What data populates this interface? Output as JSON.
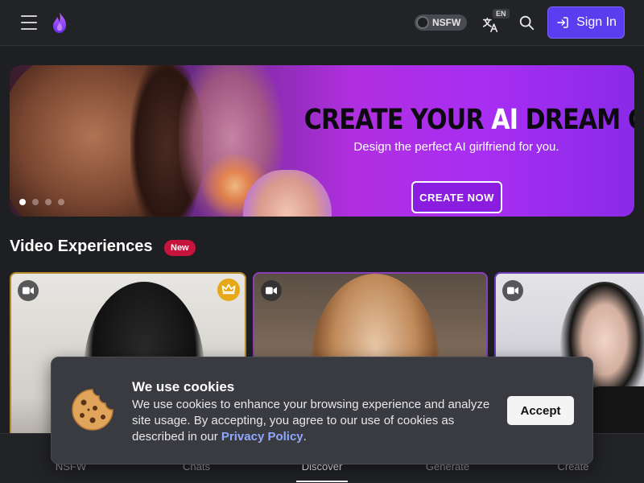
{
  "header": {
    "nsfw_toggle_label": "NSFW",
    "lang_badge": "EN",
    "signin_label": "Sign In"
  },
  "banner": {
    "title_part1": "CREATE YOUR ",
    "title_highlight": "AI",
    "title_part2": " DREAM GIRL",
    "subtitle": "Design the perfect AI girlfriend for you.",
    "cta_label": "CREATE NOW",
    "slide_count": 4,
    "active_slide": 1
  },
  "section": {
    "title": "Video Experiences",
    "badge": "New"
  },
  "cards": [
    {
      "icon": "video-camera-icon",
      "premium": true
    },
    {
      "icon": "video-camera-icon",
      "premium": false
    },
    {
      "icon": "video-camera-icon",
      "premium": false
    }
  ],
  "bottom_nav": {
    "items": [
      {
        "label": "NSFW"
      },
      {
        "label": "Chats"
      },
      {
        "label": "Discover",
        "active": true
      },
      {
        "label": "Generate"
      },
      {
        "label": "Create"
      }
    ]
  },
  "cookie": {
    "title": "We use cookies",
    "text": "We use cookies to enhance your browsing experience and analyze site usage. By accepting, you agree to our use of cookies as described in our ",
    "link_label": "Privacy Policy",
    "text_end": ".",
    "accept_label": "Accept"
  },
  "colors": {
    "accent": "#5b3df0",
    "badge_red": "#c8143c",
    "premium_gold": "#e6a817",
    "background": "#1e1f22"
  }
}
